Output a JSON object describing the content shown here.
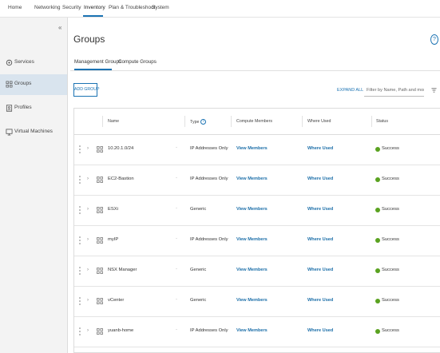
{
  "topnav": {
    "items": [
      "Home",
      "Networking",
      "Security",
      "Inventory",
      "Plan & Troubleshoot",
      "System"
    ],
    "active": "Inventory"
  },
  "sidebar": {
    "items": [
      {
        "label": "Services",
        "icon": "services-icon"
      },
      {
        "label": "Groups",
        "icon": "groups-icon",
        "active": true
      },
      {
        "label": "Profiles",
        "icon": "profiles-icon"
      },
      {
        "label": "Virtual Machines",
        "icon": "virtual-machines-icon"
      }
    ]
  },
  "page": {
    "title": "Groups",
    "help": "?"
  },
  "tabs": [
    {
      "label": "Management Groups",
      "active": true
    },
    {
      "label": "Compute Groups"
    }
  ],
  "toolbar": {
    "add_label": "ADD GROUP",
    "expand_label": "EXPAND ALL",
    "filter_placeholder": "Filter by Name, Path and more"
  },
  "table": {
    "headers": {
      "name": "Name",
      "type": "Type",
      "compute_members": "Compute Members",
      "where_used": "Where Used",
      "status": "Status"
    },
    "rows": [
      {
        "name": "10.20.1.0/24",
        "type": "IP Addresses Only",
        "members": "View Members",
        "where": "Where Used",
        "status": "Success"
      },
      {
        "name": "EC2-Bastion",
        "type": "IP Addresses Only",
        "members": "View Members",
        "where": "Where Used",
        "status": "Success"
      },
      {
        "name": "ESXi",
        "type": "Generic",
        "members": "View Members",
        "where": "Where Used",
        "status": "Success"
      },
      {
        "name": "myIP",
        "type": "IP Addresses Only",
        "members": "View Members",
        "where": "Where Used",
        "status": "Success"
      },
      {
        "name": "NSX Manager",
        "type": "Generic",
        "members": "View Members",
        "where": "Where Used",
        "status": "Success"
      },
      {
        "name": "vCenter",
        "type": "Generic",
        "members": "View Members",
        "where": "Where Used",
        "status": "Success"
      },
      {
        "name": "yuanb-home",
        "type": "IP Addresses Only",
        "members": "View Members",
        "where": "Where Used",
        "status": "Success"
      }
    ]
  },
  "colors": {
    "accent": "#1b73b3",
    "success": "#5aa220",
    "sidebar_bg": "#f3f3f3",
    "sidebar_active": "#d9e4ee"
  }
}
